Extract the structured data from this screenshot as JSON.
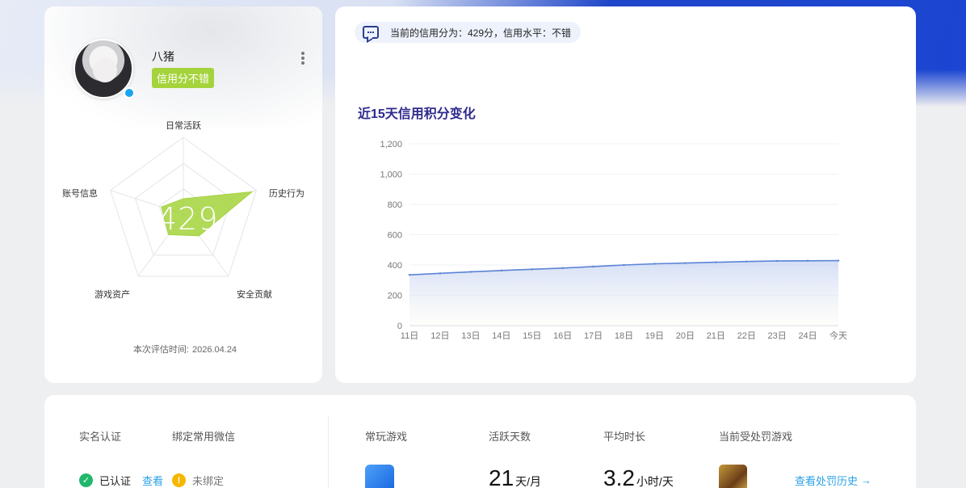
{
  "profile": {
    "username": "八猪",
    "credit_tag": "信用分不错",
    "score": "429",
    "radar_labels": [
      "日常活跃",
      "历史行为",
      "安全贡献",
      "游戏资产",
      "账号信息"
    ],
    "radar_values": [
      0.2,
      0.94,
      0.35,
      0.33,
      0.3
    ],
    "eval_time_label": "本次评估时间:",
    "eval_time_value": "2026.04.24",
    "accent_color": "#a5d33c"
  },
  "notice": {
    "text": "当前的信用分为：429分，信用水平：不错"
  },
  "chart_data": {
    "type": "area",
    "title": "近15天信用积分变化",
    "categories": [
      "11日",
      "12日",
      "13日",
      "14日",
      "15日",
      "16日",
      "17日",
      "18日",
      "19日",
      "20日",
      "21日",
      "22日",
      "23日",
      "24日",
      "今天"
    ],
    "series": [
      {
        "values": [
          335,
          345,
          355,
          364,
          372,
          380,
          390,
          400,
          408,
          413,
          418,
          423,
          427,
          428,
          429
        ]
      }
    ],
    "y_ticks": [
      "0",
      "200",
      "400",
      "600",
      "800",
      "1,000",
      "1,200"
    ],
    "ylim": [
      0,
      1200
    ],
    "grid": true,
    "line_color": "#5b84d6"
  },
  "stats": {
    "realname_label": "实名认证",
    "wechat_label": "绑定常用微信",
    "realname_status": "已认证",
    "realname_view": "查看",
    "wechat_status": "未绑定",
    "frequent_game_label": "常玩游戏",
    "active_days_label": "活跃天数",
    "active_days_value": "21",
    "active_days_unit": "天/月",
    "avg_time_label": "平均时长",
    "avg_time_value": "3.2",
    "avg_time_unit": "小时/天",
    "punished_label": "当前受处罚游戏",
    "history_link": "查看处罚历史",
    "arrow": "→"
  }
}
